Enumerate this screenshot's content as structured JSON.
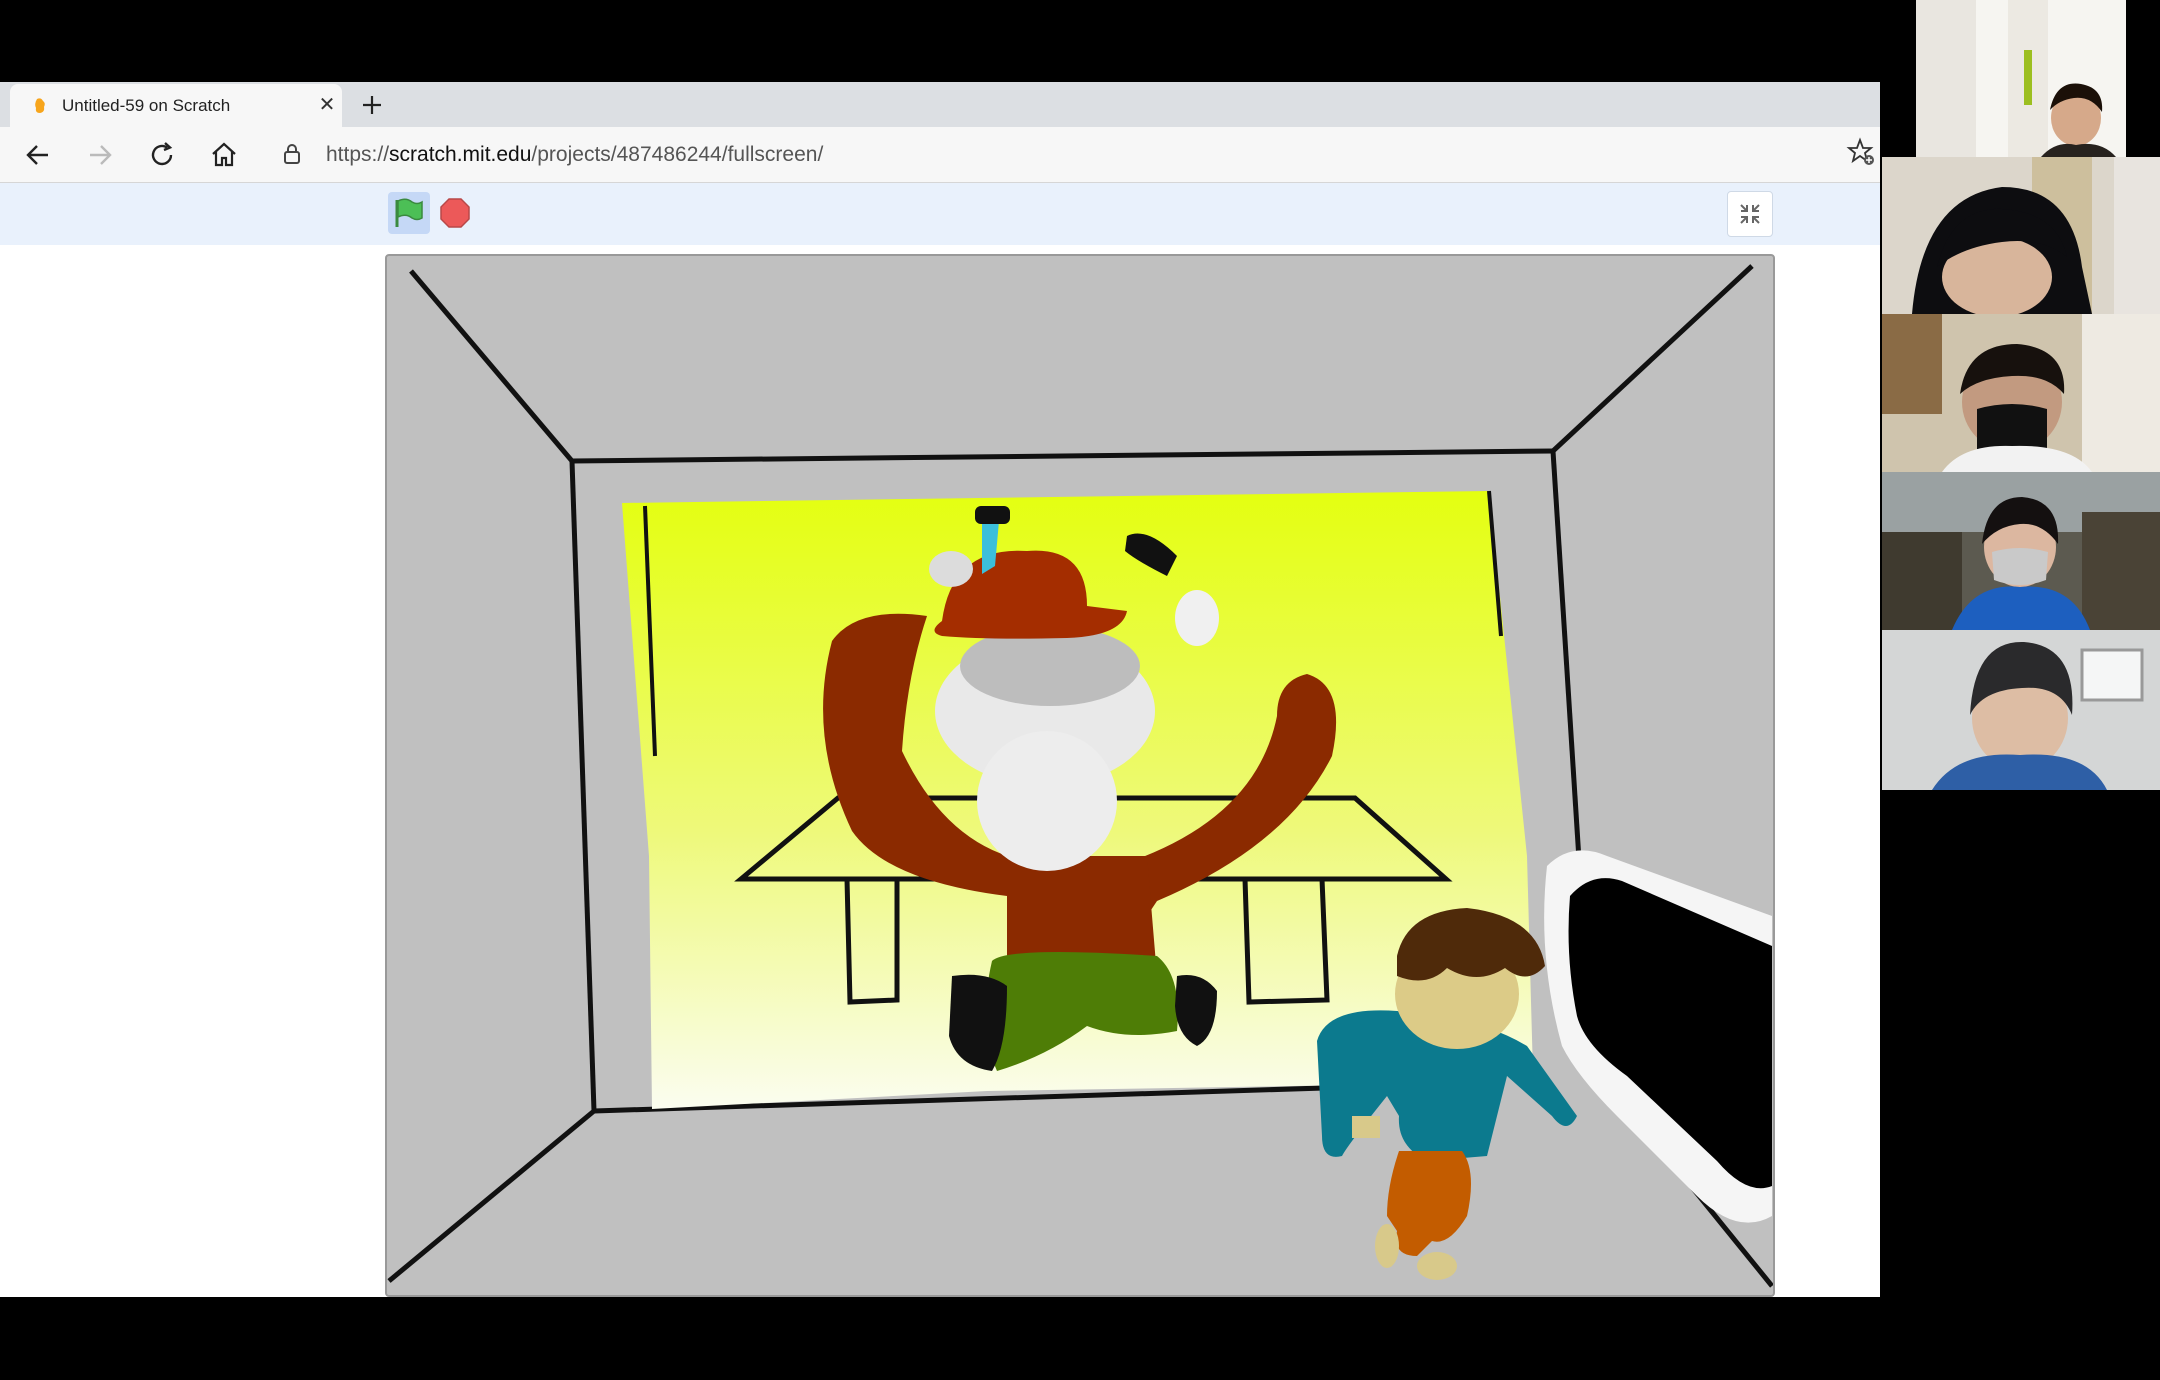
{
  "browser": {
    "tab": {
      "title": "Untitled-59 on Scratch",
      "favicon": "scratch-cat-icon",
      "close_icon": "close-icon"
    },
    "new_tab_icon": "plus-icon",
    "nav": {
      "back_icon": "arrow-left-icon",
      "forward_icon": "arrow-right-icon",
      "reload_icon": "reload-icon",
      "home_icon": "home-icon"
    },
    "address": {
      "scheme": "https://",
      "host": "scratch.mit.edu",
      "path": "/projects/487486244/fullscreen/",
      "lock_icon": "lock-icon"
    },
    "favorites_icon": "star-add-icon"
  },
  "scratch": {
    "green_flag_icon": "green-flag-icon",
    "stop_icon": "stop-sign-icon",
    "exit_fullscreen_icon": "unfullscreen-icon",
    "stage": {
      "description_scene": "hand-drawn-room"
    }
  },
  "participants": [
    {
      "id": "p1",
      "label": ""
    },
    {
      "id": "p2",
      "label": ""
    },
    {
      "id": "p3",
      "label": ""
    },
    {
      "id": "p4",
      "label": ""
    },
    {
      "id": "p5",
      "label": ""
    }
  ],
  "colors": {
    "flag_green": "#4cbf56",
    "stop_red": "#ec5959",
    "stage_bg": "#c0c0c0",
    "tabstrip_bg": "#dcdfe3"
  }
}
